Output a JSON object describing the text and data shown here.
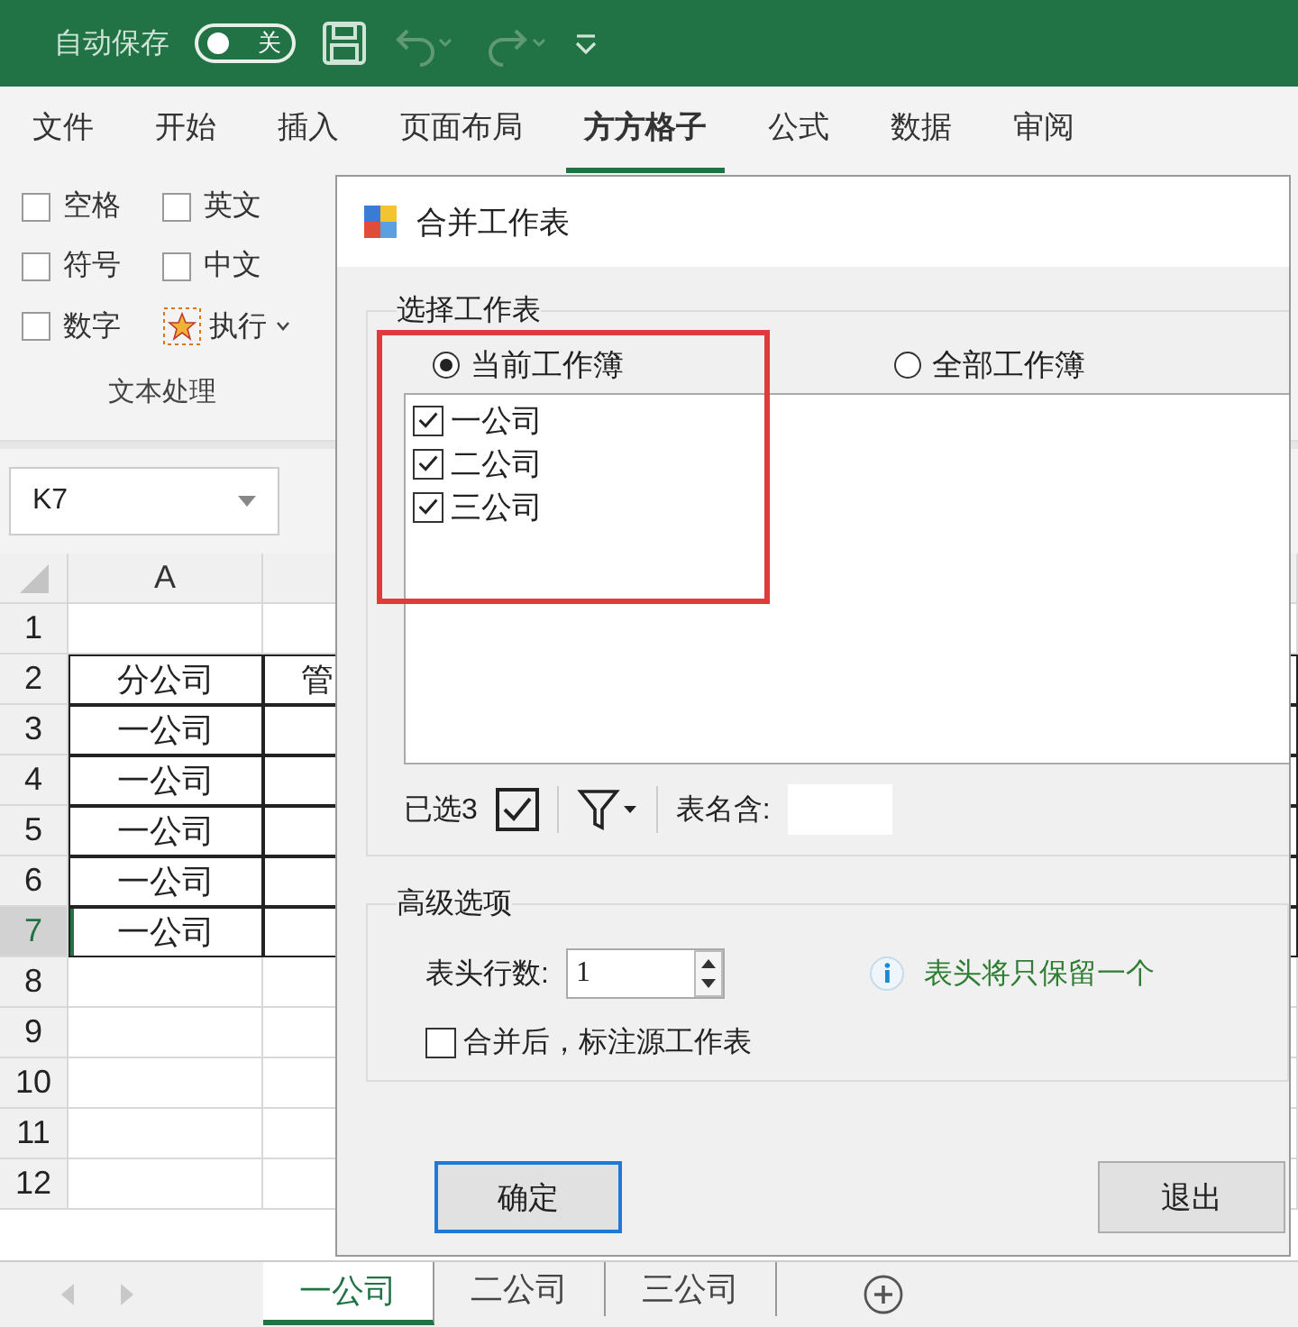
{
  "title_bar": {
    "autosave_label": "自动保存",
    "autosave_toggle": {
      "label": "关",
      "on": false
    }
  },
  "ribbon_tabs": [
    {
      "label": "文件",
      "selected": false
    },
    {
      "label": "开始",
      "selected": false
    },
    {
      "label": "插入",
      "selected": false
    },
    {
      "label": "页面布局",
      "selected": false
    },
    {
      "label": "方方格子",
      "selected": true
    },
    {
      "label": "公式",
      "selected": false
    },
    {
      "label": "数据",
      "selected": false
    },
    {
      "label": "审阅",
      "selected": false
    }
  ],
  "ribbon_group": {
    "options": [
      {
        "label": "空格",
        "checked": false
      },
      {
        "label": "英文",
        "checked": false
      },
      {
        "label": "符号",
        "checked": false
      },
      {
        "label": "中文",
        "checked": false
      },
      {
        "label": "数字",
        "checked": false
      }
    ],
    "execute_button": "执行",
    "caption": "文本处理"
  },
  "name_box": "K7",
  "sheet": {
    "columns": [
      "A"
    ],
    "rows": [
      {
        "number": "1",
        "selected": false,
        "cells": []
      },
      {
        "number": "2",
        "selected": false,
        "cells": [
          "分公司",
          "管"
        ]
      },
      {
        "number": "3",
        "selected": false,
        "cells": [
          "一公司"
        ]
      },
      {
        "number": "4",
        "selected": false,
        "cells": [
          "一公司"
        ]
      },
      {
        "number": "5",
        "selected": false,
        "cells": [
          "一公司"
        ]
      },
      {
        "number": "6",
        "selected": false,
        "cells": [
          "一公司"
        ]
      },
      {
        "number": "7",
        "selected": true,
        "cells": [
          "一公司"
        ]
      },
      {
        "number": "8",
        "selected": false,
        "cells": []
      },
      {
        "number": "9",
        "selected": false,
        "cells": []
      },
      {
        "number": "10",
        "selected": false,
        "cells": []
      },
      {
        "number": "11",
        "selected": false,
        "cells": []
      },
      {
        "number": "12",
        "selected": false,
        "cells": []
      }
    ]
  },
  "sheet_tabs": [
    {
      "label": "一公司",
      "selected": true
    },
    {
      "label": "二公司",
      "selected": false
    },
    {
      "label": "三公司",
      "selected": false
    }
  ],
  "dialog": {
    "title": "合并工作表",
    "select_group": {
      "title": "选择工作表",
      "scope": [
        {
          "label": "当前工作簿",
          "selected": true
        },
        {
          "label": "全部工作簿",
          "selected": false
        }
      ],
      "sheets": [
        {
          "label": "一公司",
          "checked": true
        },
        {
          "label": "二公司",
          "checked": true
        },
        {
          "label": "三公司",
          "checked": true
        }
      ],
      "selected_count": "已选3",
      "filter_label": "表名含:"
    },
    "advanced": {
      "title": "高级选项",
      "header_rows_label": "表头行数:",
      "header_rows": "1",
      "info": "表头将只保留一个",
      "mark_source": {
        "label": "合并后，标注源工作表",
        "checked": false
      }
    },
    "buttons": [
      {
        "label": "确定",
        "kind": "default"
      },
      {
        "label": "退出",
        "kind": "normal"
      }
    ]
  }
}
